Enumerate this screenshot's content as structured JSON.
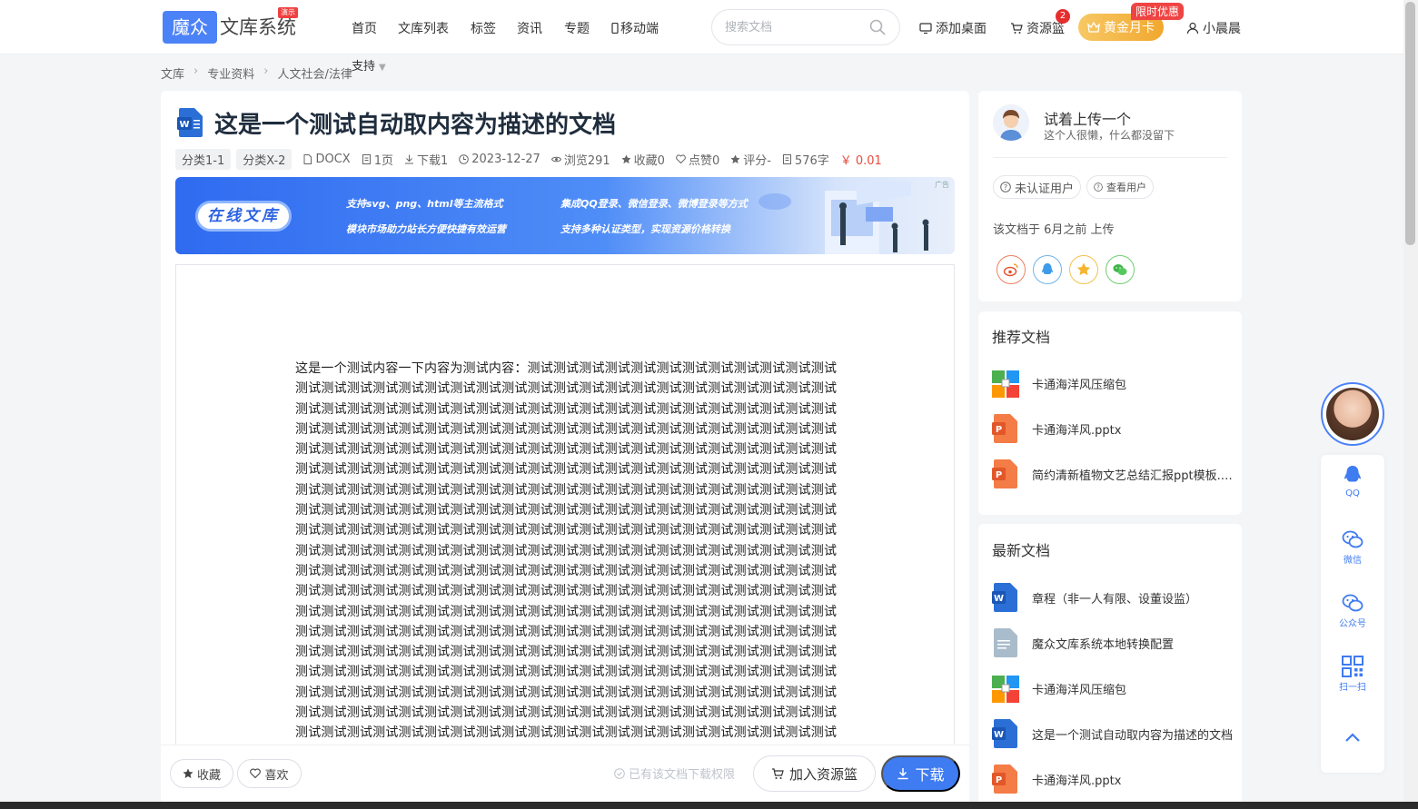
{
  "header": {
    "logo_main": "魔众",
    "logo_text": "文库系统",
    "logo_badge": "演示",
    "nav": [
      "首页",
      "文库列表",
      "标签",
      "资讯",
      "专题",
      "移动端"
    ],
    "nav_more": "支持",
    "search_placeholder": "搜索文档",
    "add_desktop": "添加桌面",
    "resource_basket": "资源篮",
    "basket_count": "2",
    "vip_label": "黄金月卡",
    "vip_tag": "限时优惠",
    "username": "小晨晨"
  },
  "breadcrumb": [
    "文库",
    "专业资料",
    "人文社会/法律"
  ],
  "document": {
    "title": "这是一个测试自动取内容为描述的文档",
    "tags": [
      "分类1-1",
      "分类X-2"
    ],
    "format": "DOCX",
    "pages": "1页",
    "downloads": "下载1",
    "date": "2023-12-27",
    "views": "浏览291",
    "favorites": "收藏0",
    "likes": "点赞0",
    "rating": "评分-",
    "words": "576字",
    "price": "￥ 0.01",
    "body": "这是一个测试内容一下内容为测试内容：测试测试测试测试测试测试测试测试测试测试测试测试测试测试测试测试测试测试测试测试测试测试测试测试测试测试测试测试测试测试测试测试测试测试测试测试测试测试测试测试测试测试测试测试测试测试测试测试测试测试测试测试测试测试测试测试测试测试测试测试测试测试测试测试测试测试测试测试测试测试测试测试测试测试测试测试测试测试测试测试测试测试测试测试测试测试测试测试测试测试测试测试测试测试测试测试测试测试测试测试测试测试测试测试测试测试测试测试测试测试测试测试测试测试测试测试测试测试测试测试测试测试测试测试测试测试测试测试测试测试测试测试测试测试测试测试测试测试测试测试测试测试测试测试测试测试测试测试测试测试测试测试测试测试测试测试测试测试测试测试测试测试测试测试测试测试测试测试测试测试测试测试测试测试测试测试测试测试测试测试测试测试测试测试测试测试测试测试测试测试测试测试测试测试测试测试测试测试测试测试测试测试测试测试测试测试测试测试测试测试测试测试测试测试测试测试测试测试测试测试测试测试测试测试测试测试测试测试测试测试测试测试测试测试测试测试测试测试测试测试测试测试测试测试测试测试测试测试测试测试测试测试测试测试测试测试测试测试测试测试测试测试测试测试测试测试测试测试测试测试测试测试测试测试测试测试测试测试测试测试测试测试测试测试测试测试测试测试测试测试测试测试测试测试测试测试测试测试测试测试测试测试测试测试测试测试测试测试测试测试测试测试测试测试测试测试测试测试测试测试测试测试测试测试测试测试测试测试测试测试测试测试测试测试测试测试测试测试测试测试测试测试测试测试测试测试测试测试测试测试测试测试测试测试测试测试测试测试测试测试测试测试测试测试测试测试测试测试测试测试测试测试测试测试测试测试测试测试测试测试测试测试测试测试测试测试测试测试测试测试测试测试测试测试测试测试测试测试测试测试测试测试测试测试测试测试测试测试测试测试测试测试测试测试测试测试测试测试测试测试测试测试测试测试测试 vvvvvvvvvvvvvvvvvvvvvvv 的就拉开发哈可是分厘卡 ask 发哈萨克卡拉　啊师傅撒艾弗森安抚安抚啊发发安抚阿萨发撒飞洒发啊发安抚爱国爱国啊给爱国啊给爱国啊给爱国"
  },
  "banner": {
    "pill": "在线文库",
    "line1": "支持svg、png、html等主流格式",
    "line2": "模块市场助力站长方便快捷有效运营",
    "line3": "集成QQ登录、微信登录、微博登录等方式",
    "line4": "支持多种认证类型，实现资源价格转换",
    "ad": "广告"
  },
  "actions": {
    "favorite": "收藏",
    "like": "喜欢",
    "permission_note": "已有该文档下载权限",
    "add_basket": "加入资源篮",
    "download": "下载"
  },
  "author": {
    "name": "试着上传一个",
    "bio": "这个人很懒，什么都没留下",
    "unverified": "未认证用户",
    "view_user": "查看用户",
    "upload_info": "该文档于 6月之前 上传"
  },
  "recommended": {
    "title": "推荐文档",
    "items": [
      "卡通海洋风压缩包",
      "卡通海洋风.pptx",
      "简约清新植物文艺总结汇报ppt模板.pptx"
    ]
  },
  "latest": {
    "title": "最新文档",
    "items": [
      "章程（非一人有限、设董设监）",
      "魔众文库系统本地转换配置",
      "卡通海洋风压缩包",
      "这是一个测试自动取内容为描述的文档",
      "卡通海洋风.pptx"
    ]
  },
  "float_bar": {
    "qq": "QQ",
    "wechat": "微信",
    "official": "公众号",
    "scan": "扫一扫"
  }
}
